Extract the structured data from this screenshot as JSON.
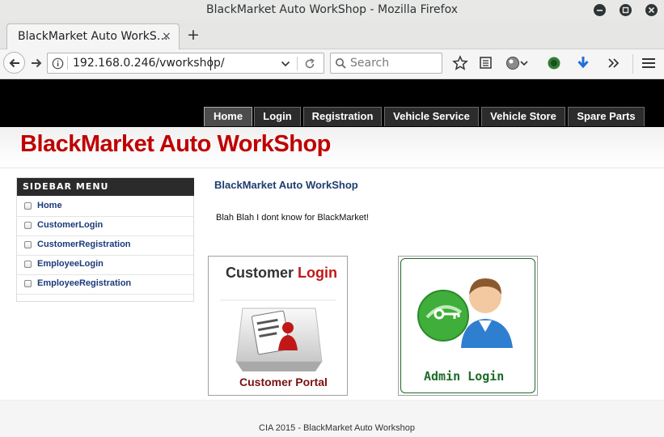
{
  "window": {
    "title": "BlackMarket Auto WorkShop - Mozilla Firefox"
  },
  "tab": {
    "title": "BlackMarket Auto WorkS…",
    "close_glyph": "×",
    "new_tab_glyph": "+"
  },
  "urlbar": {
    "url": "192.168.0.246/vworkshop/"
  },
  "searchbar": {
    "placeholder": "Search"
  },
  "site": {
    "nav": [
      {
        "label": "Home",
        "active": true
      },
      {
        "label": "Login"
      },
      {
        "label": "Registration"
      },
      {
        "label": "Vehicle Service"
      },
      {
        "label": "Vehicle Store"
      },
      {
        "label": "Spare Parts"
      }
    ],
    "title": "BlackMarket Auto WorkShop",
    "sidebar": {
      "heading": "SIDEBAR MENU",
      "items": [
        "Home",
        "CustomerLogin",
        "CustomerRegistration",
        "EmployeeLogin",
        "EmployeeRegistration"
      ]
    },
    "content": {
      "title": "BlackMarket Auto WorkShop",
      "text": "Blah Blah I dont know for BlackMarket!"
    },
    "cards": {
      "customer": {
        "title_part1": "Customer ",
        "title_part2": "Login",
        "caption": "Customer Portal"
      },
      "admin": {
        "caption": "Admin Login"
      }
    },
    "footer": "CIA 2015 - BlackMarket Auto Workshop"
  },
  "colors": {
    "brand_red": "#c00000",
    "link_blue": "#1a3a7a",
    "nav_bg": "#000000"
  }
}
